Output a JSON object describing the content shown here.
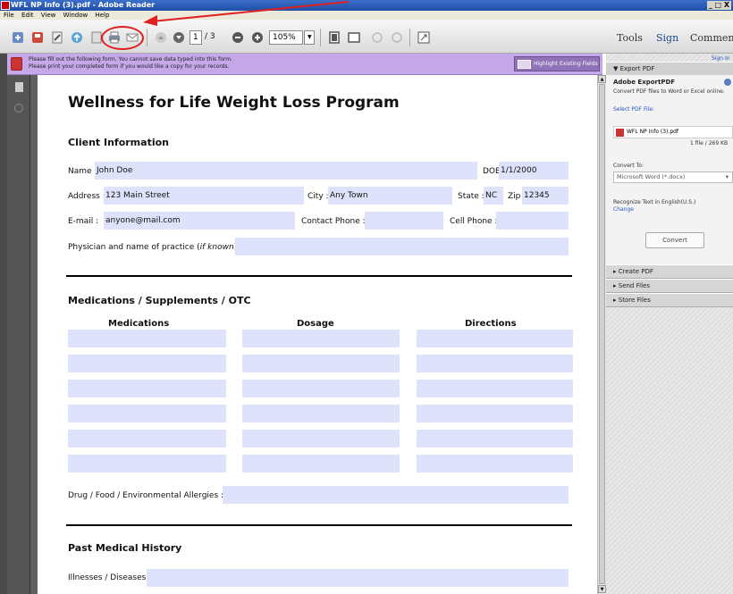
{
  "window": {
    "title": "WFL NP Info (3).pdf - Adobe Reader",
    "controls": "_ ʙ X"
  },
  "menu": [
    "File",
    "Edit",
    "View",
    "Window",
    "Help"
  ],
  "toolbar": {
    "page_current": "1",
    "page_total": "/ 3",
    "zoom": "105%",
    "tools_label": "Tools",
    "sign_label": "Sign",
    "comment_label": "Comment"
  },
  "notice": {
    "line1": "Please fill out the following form. You cannot save data typed into this form.",
    "line2": "Please print your completed form if you would like a copy for your records.",
    "highlight_button": "Highlight Existing Fields"
  },
  "form": {
    "title": "Wellness for Life Weight Loss Program",
    "client_section": "Client Information",
    "name_label": "Name :",
    "name_value": "John Doe",
    "dob_label": "DOB",
    "dob_value": "1/1/2000",
    "address_label": "Address :",
    "address_value": "123 Main Street",
    "city_label": "City :",
    "city_value": "Any Town",
    "state_label": "State :",
    "state_value": "NC",
    "zip_label": "Zip :",
    "zip_value": "12345",
    "email_label": "E-mail :",
    "email_value": "anyone@mail.com",
    "contact_phone_label": "Contact Phone :",
    "contact_phone_value": "",
    "cell_phone_label": "Cell Phone :",
    "cell_phone_value": "",
    "physician_label": "Physician and name of practice (",
    "physician_italic": "if known",
    "physician_end": ") :",
    "physician_value": "",
    "meds_section": "Medications / Supplements / OTC",
    "col_medications": "Medications",
    "col_dosage": "Dosage",
    "col_directions": "Directions",
    "allergies_label": "Drug / Food / Environmental Allergies :",
    "allergies_value": "",
    "history_section": "Past Medical History",
    "illnesses_label": "Illnesses / Diseases :",
    "illnesses_value": ""
  },
  "panel": {
    "sign_in": "Sign In",
    "export_header": "Export PDF",
    "export_title": "Adobe ExportPDF",
    "export_desc": "Convert PDF files to Word or Excel online.",
    "select_label": "Select PDF File:",
    "file_name": "WFL NP Info (3).pdf",
    "file_count": "1 file / 269 KB",
    "convert_to_label": "Convert To:",
    "convert_to_value": "Microsoft Word (*.docx)",
    "recognize_text": "Recognize Text in English(U.S.)",
    "change_link": "Change",
    "convert_button": "Convert",
    "create_pdf": "Create PDF",
    "send_files": "Send Files",
    "store_files": "Store Files"
  },
  "colors": {
    "field_bg": "#dfe2fb",
    "notice_bg": "#c6a8e9",
    "annotation": "#e02020"
  },
  "icons": [
    "create-pdf-icon",
    "save-icon",
    "edit-icon",
    "upload-icon",
    "save-disk-icon",
    "print-icon",
    "email-icon",
    "prev-page-icon",
    "next-page-icon",
    "zoom-out-icon",
    "zoom-in-icon",
    "fit-page-icon",
    "fit-width-icon",
    "read-mode-icon"
  ]
}
